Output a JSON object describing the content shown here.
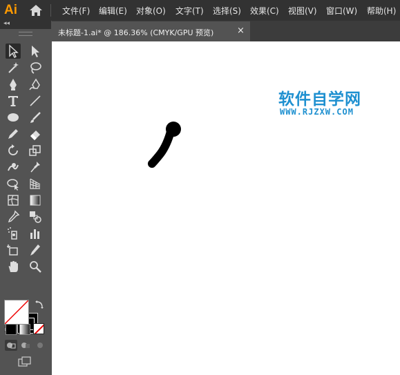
{
  "app": {
    "logo_text": "Ai",
    "accent": "#ff9a00"
  },
  "menu": [
    {
      "label": "文件(F)"
    },
    {
      "label": "编辑(E)"
    },
    {
      "label": "对象(O)"
    },
    {
      "label": "文字(T)"
    },
    {
      "label": "选择(S)"
    },
    {
      "label": "效果(C)"
    },
    {
      "label": "视图(V)"
    },
    {
      "label": "窗口(W)"
    },
    {
      "label": "帮助(H)"
    }
  ],
  "document_tab": {
    "title": "未标题-1.ai* @ 186.36% (CMYK/GPU 预览)",
    "close": "×"
  },
  "toolbar": {
    "collapse": "◂◂",
    "tools": [
      "selection-tool-icon",
      "direct-selection-tool-icon",
      "magic-wand-tool-icon",
      "lasso-tool-icon",
      "pen-tool-icon",
      "curvature-tool-icon",
      "type-tool-icon",
      "line-segment-tool-icon",
      "ellipse-tool-icon",
      "paintbrush-tool-icon",
      "pencil-tool-icon",
      "eraser-tool-icon",
      "rotate-tool-icon",
      "scale-tool-icon",
      "warp-tool-icon",
      "puppet-warp-tool-icon",
      "shape-builder-tool-icon",
      "perspective-grid-tool-icon",
      "mesh-tool-icon",
      "gradient-tool-icon",
      "eyedropper-tool-icon",
      "blend-tool-icon",
      "symbol-sprayer-tool-icon",
      "column-graph-tool-icon",
      "artboard-tool-icon",
      "slice-tool-icon",
      "hand-tool-icon",
      "zoom-tool-icon"
    ]
  },
  "watermark": {
    "chinese": "软件自学网",
    "url": "WWW.RJZXW.COM",
    "color": "#1e90d0"
  }
}
